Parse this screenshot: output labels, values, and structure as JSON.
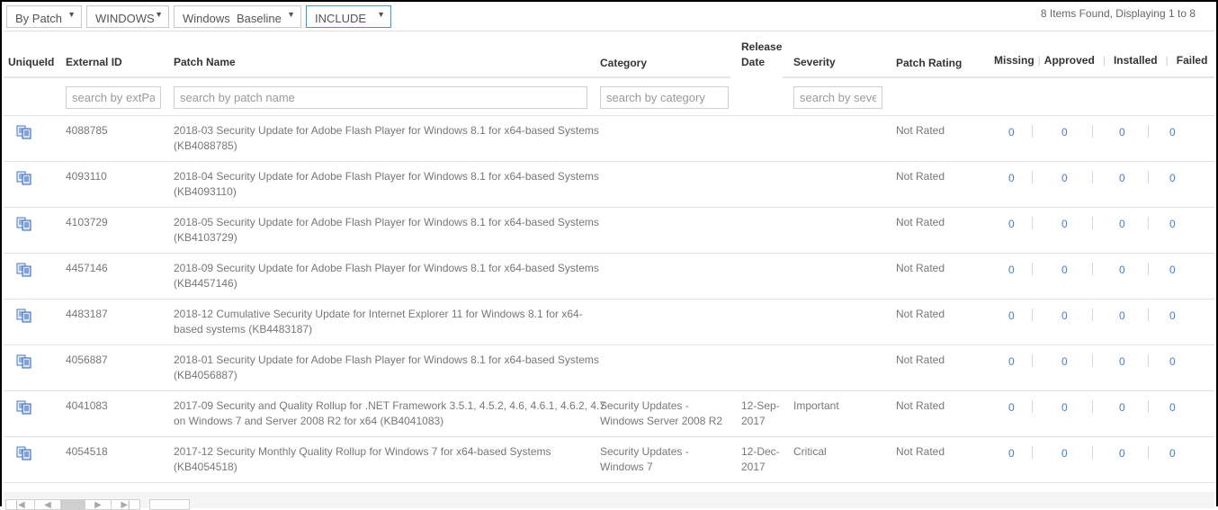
{
  "toolbar": {
    "view_select": "By Patch",
    "os_select": "WINDOWS",
    "baseline_select": "Windows  Baseline",
    "filter_select": "INCLUDE",
    "caret": "▼"
  },
  "status": {
    "items_found": "8 Items Found, Displaying 1 to 8"
  },
  "columns": {
    "unique_id": "UniqueId",
    "external_id": "External ID",
    "patch_name": "Patch Name",
    "category": "Category",
    "release_date_1": "Release",
    "release_date_2": "Date",
    "severity": "Severity",
    "patch_rating": "Patch Rating",
    "missing": "Missing",
    "approved": "Approved",
    "installed": "Installed",
    "failed": "Failed",
    "sep": "|"
  },
  "filters": {
    "external_id_placeholder": "search by extPa",
    "patch_name_placeholder": "search by patch name",
    "category_placeholder": "search by category",
    "severity_placeholder": "search by seve"
  },
  "rows": [
    {
      "icon": "copy-icon",
      "external_id": "4088785",
      "name_1": "2018-03 Security Update for Adobe Flash Player for Windows 8.1 for x64-based Systems",
      "name_2": "(KB4088785)",
      "category_1": "",
      "category_2": "",
      "date_1": "",
      "date_2": "",
      "severity": "",
      "rating": "Not Rated",
      "missing": "0",
      "approved": "0",
      "installed": "0",
      "failed": "0"
    },
    {
      "icon": "copy-icon",
      "external_id": "4093110",
      "name_1": "2018-04 Security Update for Adobe Flash Player for Windows 8.1 for x64-based Systems",
      "name_2": "(KB4093110)",
      "category_1": "",
      "category_2": "",
      "date_1": "",
      "date_2": "",
      "severity": "",
      "rating": "Not Rated",
      "missing": "0",
      "approved": "0",
      "installed": "0",
      "failed": "0"
    },
    {
      "icon": "copy-icon",
      "external_id": "4103729",
      "name_1": "2018-05 Security Update for Adobe Flash Player for Windows 8.1 for x64-based Systems",
      "name_2": "(KB4103729)",
      "category_1": "",
      "category_2": "",
      "date_1": "",
      "date_2": "",
      "severity": "",
      "rating": "Not Rated",
      "missing": "0",
      "approved": "0",
      "installed": "0",
      "failed": "0"
    },
    {
      "icon": "copy-icon",
      "external_id": "4457146",
      "name_1": "2018-09 Security Update for Adobe Flash Player for Windows 8.1 for x64-based Systems",
      "name_2": "(KB4457146)",
      "category_1": "",
      "category_2": "",
      "date_1": "",
      "date_2": "",
      "severity": "",
      "rating": "Not Rated",
      "missing": "0",
      "approved": "0",
      "installed": "0",
      "failed": "0"
    },
    {
      "icon": "copy-icon",
      "external_id": "4483187",
      "name_1": "2018-12 Cumulative Security Update for Internet Explorer 11 for Windows 8.1 for x64-",
      "name_2": "based systems (KB4483187)",
      "category_1": "",
      "category_2": "",
      "date_1": "",
      "date_2": "",
      "severity": "",
      "rating": "Not Rated",
      "missing": "0",
      "approved": "0",
      "installed": "0",
      "failed": "0"
    },
    {
      "icon": "copy-icon",
      "external_id": "4056887",
      "name_1": "2018-01 Security Update for Adobe Flash Player for Windows 8.1 for x64-based Systems",
      "name_2": "(KB4056887)",
      "category_1": "",
      "category_2": "",
      "date_1": "",
      "date_2": "",
      "severity": "",
      "rating": "Not Rated",
      "missing": "0",
      "approved": "0",
      "installed": "0",
      "failed": "0"
    },
    {
      "icon": "copy-icon",
      "external_id": "4041083",
      "name_1": "2017-09 Security and Quality Rollup for .NET Framework 3.5.1, 4.5.2, 4.6, 4.6.1, 4.6.2, 4.7",
      "name_2": "on Windows 7 and Server 2008 R2 for x64 (KB4041083)",
      "category_1": "Security Updates -",
      "category_2": "Windows Server 2008 R2",
      "date_1": "12-Sep-",
      "date_2": "2017",
      "severity": "Important",
      "rating": "Not Rated",
      "missing": "0",
      "approved": "0",
      "installed": "0",
      "failed": "0"
    },
    {
      "icon": "copy-icon",
      "external_id": "4054518",
      "name_1": "2017-12 Security Monthly Quality Rollup for Windows 7 for x64-based Systems",
      "name_2": "(KB4054518)",
      "category_1": "Security Updates -",
      "category_2": "Windows 7",
      "date_1": "12-Dec-",
      "date_2": "2017",
      "severity": "Critical",
      "rating": "Not Rated",
      "missing": "0",
      "approved": "0",
      "installed": "0",
      "failed": "0"
    }
  ],
  "pager": {
    "first": "|◀",
    "prev": "◀",
    "next": "▶",
    "last": "▶|"
  }
}
